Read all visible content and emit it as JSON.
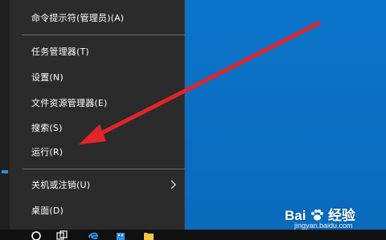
{
  "menu": {
    "items": [
      {
        "label": "命令提示符(管理员)(A)"
      },
      {
        "label": "任务管理器(T)"
      },
      {
        "label": "设置(N)"
      },
      {
        "label": "文件资源管理器(E)"
      },
      {
        "label": "搜索(S)"
      },
      {
        "label": "运行(R)"
      },
      {
        "label": "关机或注销(U)"
      },
      {
        "label": "桌面(D)"
      }
    ]
  },
  "watermark": {
    "brand": "Bai",
    "brand_suffix": "经验",
    "url": "jingyan.baidu.com"
  },
  "taskbar": {
    "icons": [
      "cortana-search-icon",
      "task-view-icon",
      "edge-browser-icon",
      "store-icon",
      "file-explorer-icon"
    ]
  },
  "annotation": {
    "arrow_color": "#e2242b"
  },
  "colors": {
    "menu_bg": "#2b2b2b",
    "desktop": "#0b6fc2",
    "taskbar": "#101010"
  }
}
